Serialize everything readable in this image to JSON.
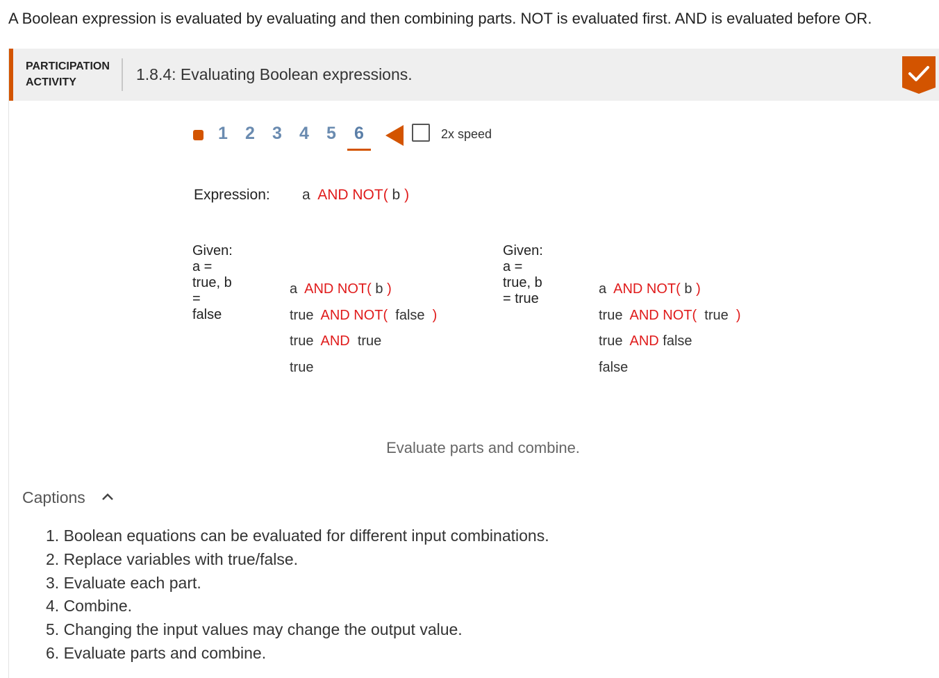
{
  "intro_text": "A Boolean expression is evaluated by evaluating and then combining parts. NOT is evaluated first. AND is evaluated before OR.",
  "activity": {
    "type_line1": "PARTICIPATION",
    "type_line2": "ACTIVITY",
    "title": "1.8.4: Evaluating Boolean expressions.",
    "completed_icon": "checkmark-icon",
    "accent_color": "#d35400"
  },
  "controls": {
    "steps": [
      "1",
      "2",
      "3",
      "4",
      "5",
      "6"
    ],
    "current_step": "6",
    "speed_label": "2x speed"
  },
  "animation": {
    "expression_label": "Expression:",
    "expression": {
      "a": "a",
      "op": "AND NOT(",
      "b": "b",
      "close": ")"
    },
    "left": {
      "given": "Given: a = true, b = false",
      "line1": {
        "a": "a",
        "op": "AND NOT(",
        "b": "b",
        "close": ")"
      },
      "line2": {
        "a": "true",
        "op": "AND NOT(",
        "b": "false",
        "close": ")"
      },
      "line3": {
        "a": "true",
        "op": "AND",
        "b": "true"
      },
      "line4": "true"
    },
    "right": {
      "given": "Given: a = true, b = true",
      "line1": {
        "a": "a",
        "op": "AND NOT(",
        "b": "b",
        "close": ")"
      },
      "line2": {
        "a": "true",
        "op": "AND NOT(",
        "b": "true",
        "close": ")"
      },
      "line3": {
        "a": "true",
        "op": "AND",
        "b": "false"
      },
      "line4": "false"
    },
    "current_caption": "Evaluate parts and combine."
  },
  "captions": {
    "toggle_label": "Captions",
    "items": [
      "1. Boolean equations can be evaluated for different input combinations.",
      "2. Replace variables with true/false.",
      "3. Evaluate each part.",
      "4. Combine.",
      "5. Changing the input values may change the output value.",
      "6. Evaluate parts and combine."
    ]
  }
}
